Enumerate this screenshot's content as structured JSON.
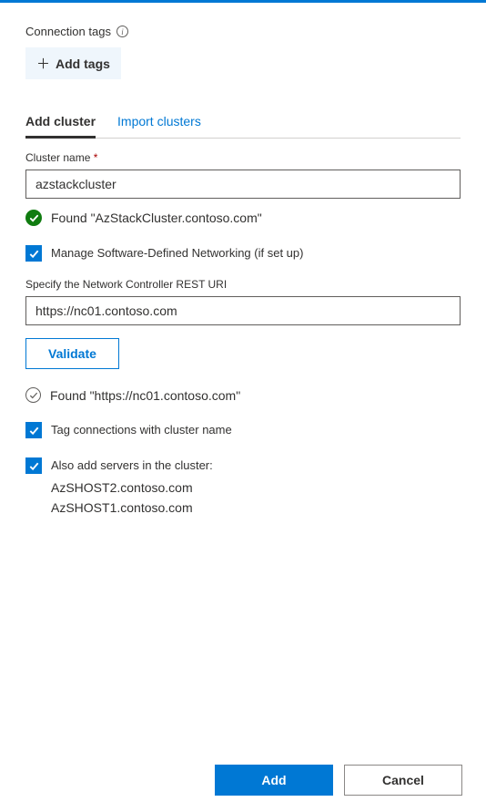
{
  "header": {
    "tags_label": "Connection tags",
    "add_tags_btn": "Add tags"
  },
  "tabs": {
    "add_cluster": "Add cluster",
    "import_clusters": "Import clusters"
  },
  "cluster": {
    "name_label": "Cluster name",
    "name_value": "azstackcluster",
    "found_msg": "Found \"AzStackCluster.contoso.com\""
  },
  "sdn": {
    "checkbox_label": "Manage Software-Defined Networking (if set up)",
    "uri_label": "Specify the Network Controller REST URI",
    "uri_value": "https://nc01.contoso.com",
    "validate_btn": "Validate",
    "found_msg": "Found \"https://nc01.contoso.com\""
  },
  "options": {
    "tag_connections": "Tag connections with cluster name",
    "also_add_servers": "Also add servers in the cluster:",
    "servers": {
      "s1": "AzSHOST2.contoso.com",
      "s2": "AzSHOST1.contoso.com"
    }
  },
  "footer": {
    "add": "Add",
    "cancel": "Cancel"
  }
}
